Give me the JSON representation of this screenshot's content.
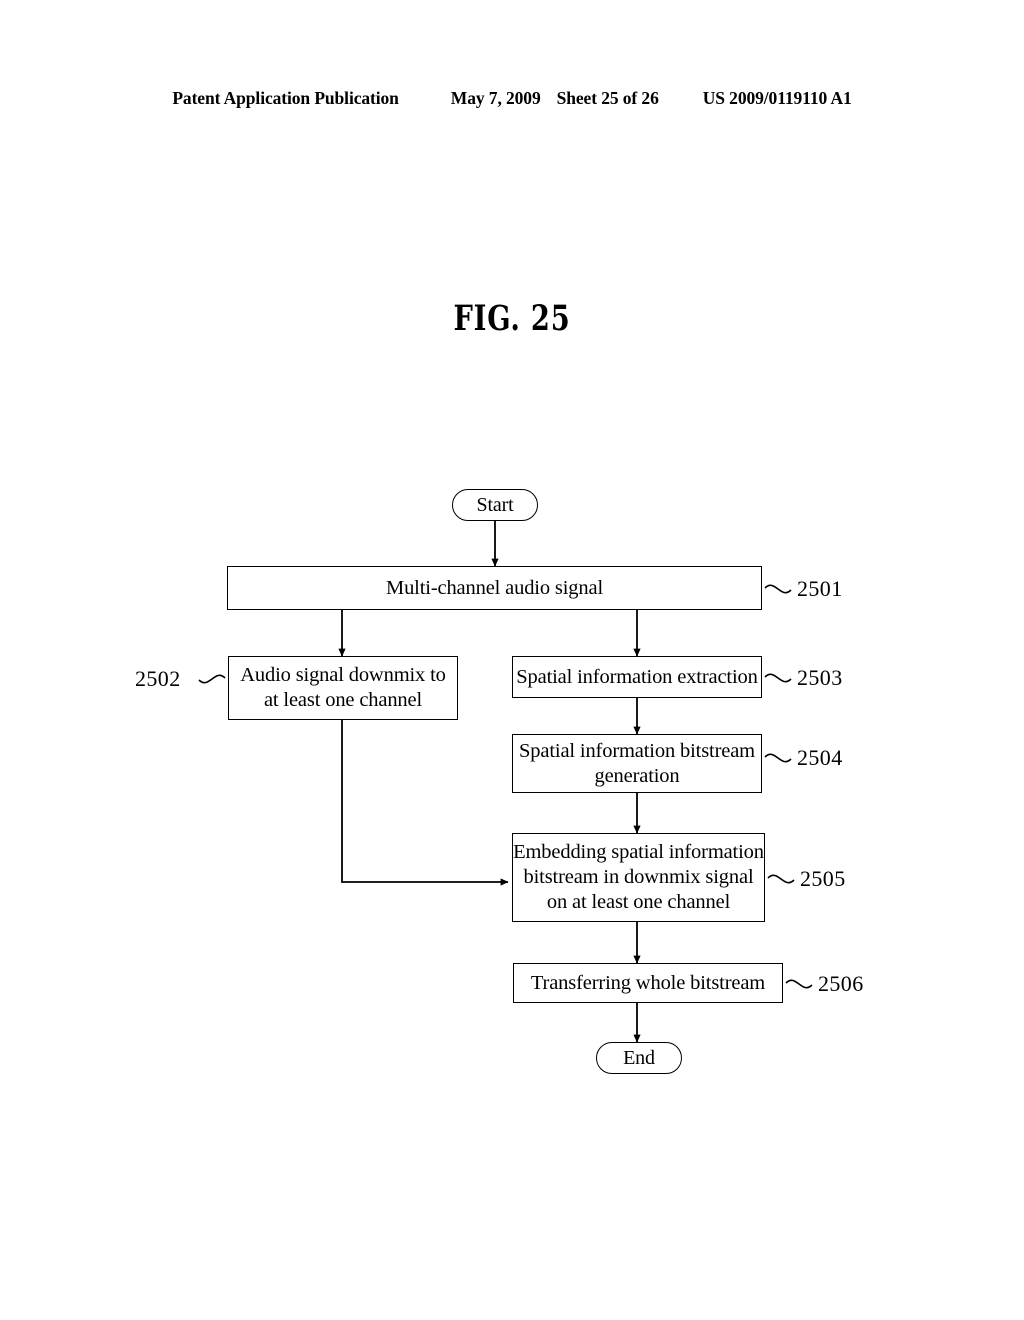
{
  "header": {
    "publication": "Patent Application Publication",
    "date": "May 7, 2009",
    "sheet": "Sheet 25 of 26",
    "patent_number": "US 2009/0119110 A1"
  },
  "figure": {
    "title": "FIG. 25"
  },
  "flowchart": {
    "type": "flowchart",
    "start_label": "Start",
    "end_label": "End",
    "nodes": [
      {
        "ref": "2501",
        "text": "Multi-channel audio signal"
      },
      {
        "ref": "2502",
        "text": "Audio signal downmix to\nat least one channel"
      },
      {
        "ref": "2503",
        "text": "Spatial information extraction"
      },
      {
        "ref": "2504",
        "text": "Spatial information bitstream\ngeneration"
      },
      {
        "ref": "2505",
        "text": "Embedding spatial information\nbitstream in downmix signal\non at least one channel"
      },
      {
        "ref": "2506",
        "text": "Transferring whole bitstream"
      }
    ],
    "edges": [
      {
        "from": "start",
        "to": "2501"
      },
      {
        "from": "2501",
        "to": "2502"
      },
      {
        "from": "2501",
        "to": "2503"
      },
      {
        "from": "2503",
        "to": "2504"
      },
      {
        "from": "2504",
        "to": "2505"
      },
      {
        "from": "2502",
        "to": "2505"
      },
      {
        "from": "2505",
        "to": "2506"
      },
      {
        "from": "2506",
        "to": "end"
      }
    ],
    "line_color": "#000000"
  }
}
